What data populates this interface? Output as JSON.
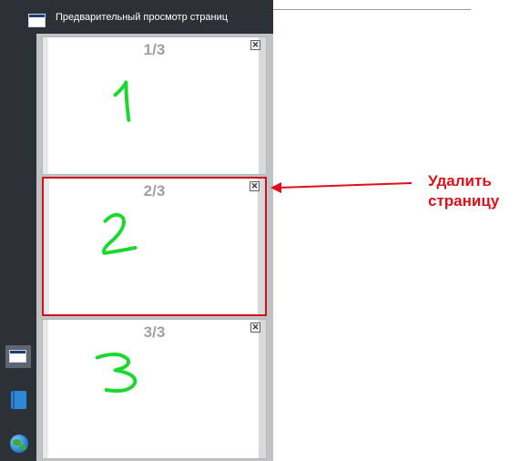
{
  "panel": {
    "title": "Предварительный просмотр страниц"
  },
  "pages": [
    {
      "label": "1/3",
      "content": "1",
      "selected": false
    },
    {
      "label": "2/3",
      "content": "2",
      "selected": true
    },
    {
      "label": "3/3",
      "content": "3",
      "selected": false
    }
  ],
  "delete_glyph": "✕",
  "sidebar": {
    "buttons": [
      "page-preview-icon",
      "book-icon",
      "globe-icon"
    ]
  },
  "annotation": {
    "text": "Удалить\nстраницу",
    "color": "#e0101a"
  },
  "colors": {
    "sidebar": "#2c3138",
    "selection": "#d0131b",
    "handwriting": "#19d92c"
  }
}
